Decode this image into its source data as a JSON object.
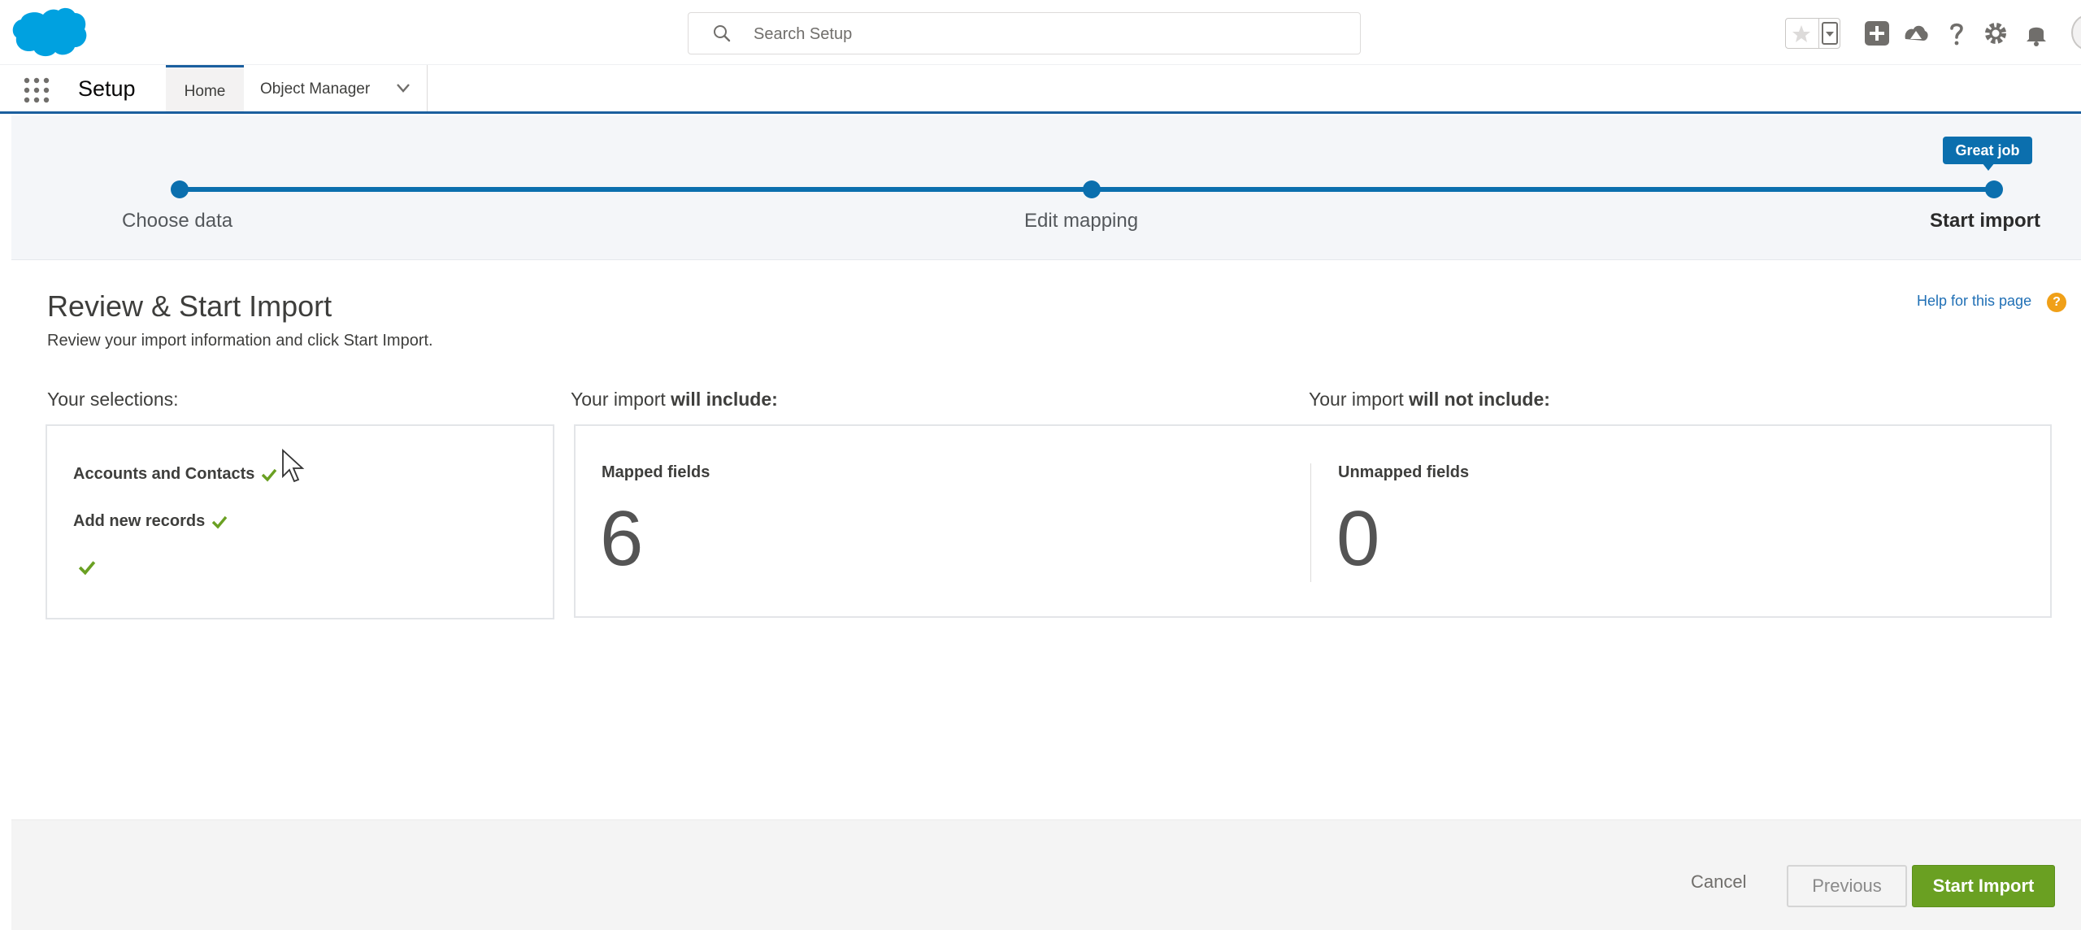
{
  "header": {
    "search": {
      "placeholder": "Search Setup"
    }
  },
  "context_bar": {
    "app_name": "Setup",
    "tabs": [
      {
        "label": "Home",
        "active": true
      },
      {
        "label": "Object Manager",
        "active": false
      }
    ]
  },
  "wizard": {
    "steps": [
      {
        "label": "Choose data"
      },
      {
        "label": "Edit mapping"
      },
      {
        "label": "Start import",
        "active": true
      }
    ],
    "badge": "Great job"
  },
  "main": {
    "title": "Review & Start Import",
    "subtitle": "Review your import information and click Start Import.",
    "help_link": "Help for this page",
    "selections": {
      "heading": "Your selections:",
      "items": [
        "Accounts and Contacts",
        "Add new records"
      ]
    },
    "include": {
      "heading_prefix": "Your import ",
      "heading_bold": "will include:",
      "label": "Mapped fields",
      "value": "6"
    },
    "exclude": {
      "heading_prefix": "Your import ",
      "heading_bold": "will not include:",
      "label": "Unmapped fields",
      "value": "0"
    }
  },
  "footer": {
    "cancel": "Cancel",
    "previous": "Previous",
    "start": "Start Import"
  },
  "colors": {
    "brand_blue": "#0b6fae",
    "logo_blue": "#00a1e0",
    "start_green": "#6aa022",
    "check_green": "#6aa022"
  },
  "icons": [
    "salesforce-cloud-logo",
    "search-icon",
    "star-icon",
    "chevron-down-icon",
    "plus-icon",
    "trailhead-icon",
    "help-icon",
    "gear-icon",
    "bell-icon",
    "app-launcher-icon",
    "check-icon"
  ]
}
